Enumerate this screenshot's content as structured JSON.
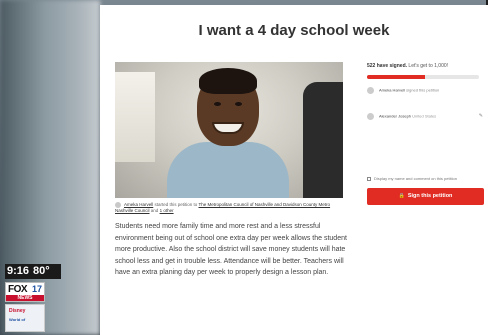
{
  "page": {
    "title": "I want a 4 day school week",
    "starter": {
      "name": "Ameka Harvell",
      "text_mid": "started this petition to",
      "target": "The Metropolitan Council of Nashville and Davidson County Metro Nashville Council",
      "text_and": "and",
      "other": "1 other"
    },
    "body": "Students need more family time and more rest and a less stressful environment being out of school one extra day per week allows the student more productive. Also the school district will save money students will hate school less and get in trouble less. Attendance will be better. Teachers will have an extra planing day per week to properly design a lesson plan."
  },
  "sidebar": {
    "signed_count": "522 have signed.",
    "signed_goal_text": "Let's get to 1,000!",
    "progress_fraction": 0.52,
    "signers": [
      {
        "name": "Ameka Harvell",
        "action": "signed this petition",
        "location": ""
      },
      {
        "name": "Alexander Joseph",
        "action": "",
        "location": "United States"
      }
    ],
    "display_option": "Display my name and comment on this petition",
    "sign_button": "Sign this petition"
  },
  "tv": {
    "time": "9:16",
    "temp": "80°",
    "station": "FOX",
    "channel": "17",
    "news": "NEWS",
    "badge_line1": "Disney",
    "badge_line2": "World of"
  },
  "colors": {
    "accent": "#e02c23",
    "text": "#444444"
  }
}
